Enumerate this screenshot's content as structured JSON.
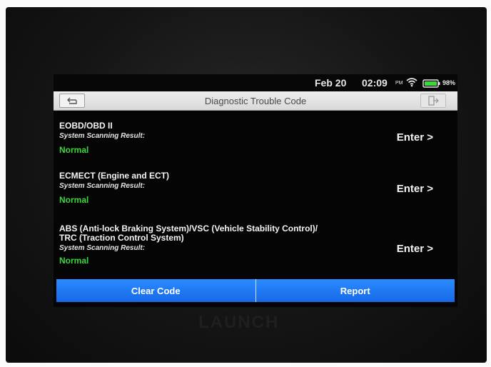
{
  "status_bar": {
    "date": "Feb 20",
    "time": "02:09",
    "ampm": "PM",
    "battery_pct": "98%",
    "icons": [
      "wifi-icon",
      "battery-icon"
    ]
  },
  "header": {
    "title": "Diagnostic Trouble Code",
    "back_icon": "back-arrow-icon",
    "exit_icon": "exit-icon"
  },
  "systems": [
    {
      "name": "EOBD/OBD II",
      "result_label": "System Scanning Result:",
      "result": "Normal",
      "action": "Enter >"
    },
    {
      "name": "ECMECT (Engine and ECT)",
      "result_label": "System Scanning Result:",
      "result": "Normal",
      "action": "Enter >"
    },
    {
      "name_line1": "ABS (Anti-lock Braking System)/VSC (Vehicle Stability Control)/",
      "name_line2": "TRC (Traction Control System)",
      "result_label": "System Scanning Result:",
      "result": "Normal",
      "action": "Enter >"
    }
  ],
  "footer": {
    "clear_label": "Clear Code",
    "report_label": "Report"
  },
  "device": {
    "brand": "LAUNCH"
  },
  "colors": {
    "accent": "#1e7ff0",
    "normal_status": "#3ed63c",
    "screen_bg": "#050505"
  }
}
